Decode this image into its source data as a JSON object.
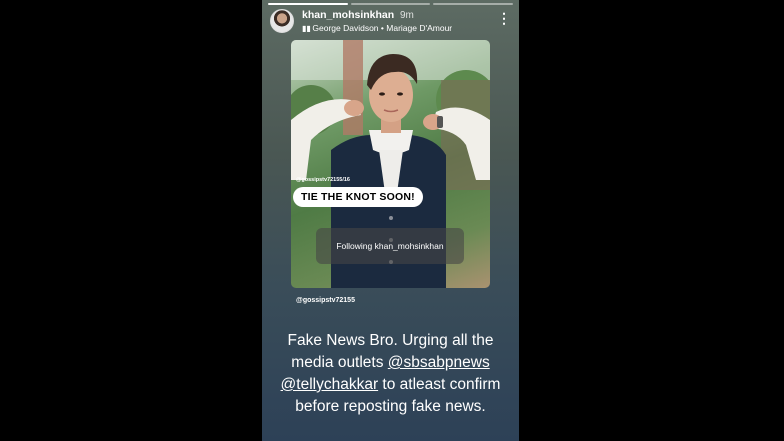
{
  "story": {
    "progress_segments": 3,
    "progress_done": 1
  },
  "header": {
    "username": "khan_mohsinkhan",
    "time": "9m",
    "music_artist": "George Davidson",
    "music_separator": "•",
    "music_track": "Mariage D'Amour",
    "menu_icon": "more-vertical-icon"
  },
  "reposted_post": {
    "watermark": "@gossipstv72155/16",
    "sticker_text": "TIE THE KNOT SOON!",
    "following_text": "Following khan_mohsinkhan",
    "repost_handle": "@gossipstv72155"
  },
  "caption": {
    "line1": "Fake News Bro. Urging all the",
    "line2_prefix": "media outlets ",
    "mention1": "@sbsabpnews",
    "mention2": "@tellychakkar",
    "line3_suffix": " to atleast confirm",
    "line4": "before reposting fake news."
  }
}
